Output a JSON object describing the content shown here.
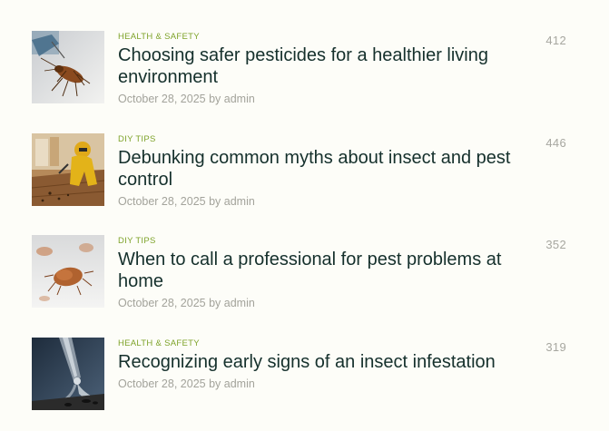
{
  "posts": [
    {
      "category": "Health & Safety",
      "title": "Choosing safer pesticides for a healthier living environment",
      "date": "October 28, 2025",
      "by": "by",
      "author": "admin",
      "count": "412",
      "image_subject": "cockroach-on-white-floor"
    },
    {
      "category": "DIY Tips",
      "title": "Debunking common myths about insect and pest control",
      "date": "October 28, 2025",
      "by": "by",
      "author": "admin",
      "count": "446",
      "image_subject": "exterminator-in-yellow-suit"
    },
    {
      "category": "DIY Tips",
      "title": "When to call a professional for pest problems at home",
      "date": "October 28, 2025",
      "by": "by",
      "author": "admin",
      "count": "352",
      "image_subject": "bed-bugs-on-fabric"
    },
    {
      "category": "Health & Safety",
      "title": "Recognizing early signs of an insect infestation",
      "date": "October 28, 2025",
      "by": "by",
      "author": "admin",
      "count": "319",
      "image_subject": "spray-nozzle-on-insects"
    }
  ],
  "colors": {
    "background": "#fdfdf8",
    "category": "#7ea32a",
    "title": "#15302c",
    "meta": "#a3a39b"
  }
}
